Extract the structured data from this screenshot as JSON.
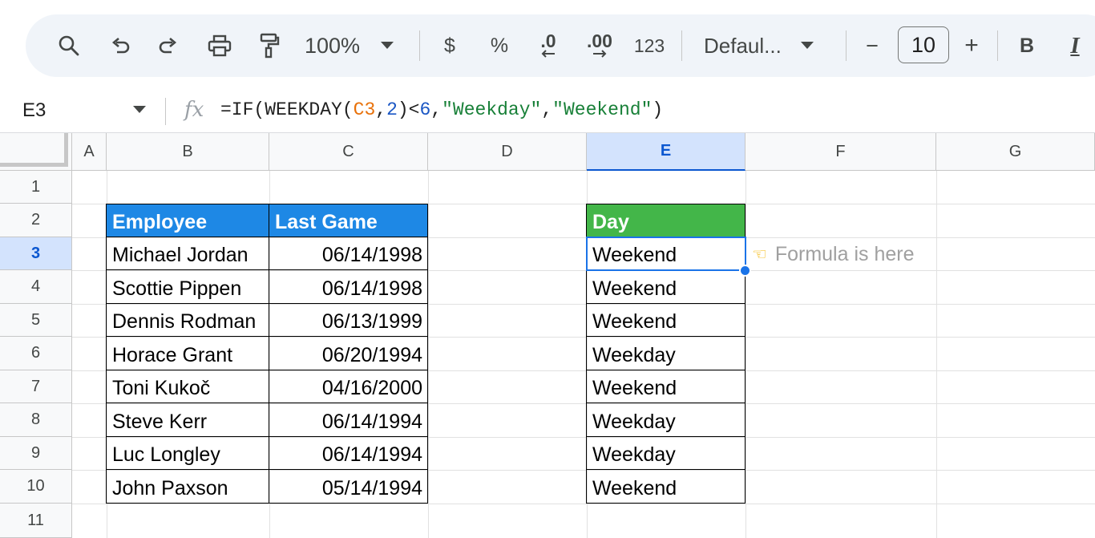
{
  "toolbar": {
    "zoom": "100%",
    "currency": "$",
    "percent": "%",
    "decrease_decimal": ".0",
    "increase_decimal": ".00",
    "more_formats": "123",
    "font_family": "Defaul...",
    "font_size": "10",
    "bold": "B",
    "italic": "I",
    "minus": "−",
    "plus": "+"
  },
  "formula_bar": {
    "name_box": "E3",
    "fx": "fx",
    "formula_parts": {
      "p1": "=IF(WEEKDAY(",
      "p2": "C3",
      "p3": ",",
      "p4": "2",
      "p5": ")<",
      "p6": "6",
      "p7": ",",
      "p8": "\"Weekday\"",
      "p9": ",",
      "p10": "\"Weekend\"",
      "p11": ")"
    }
  },
  "columns": [
    "A",
    "B",
    "C",
    "D",
    "E",
    "F",
    "G"
  ],
  "rows": [
    "1",
    "2",
    "3",
    "4",
    "5",
    "6",
    "7",
    "8",
    "9",
    "10",
    "11"
  ],
  "table": {
    "header_employee": "Employee",
    "header_last_game": "Last Game",
    "header_day": "Day",
    "rows": [
      {
        "employee": "Michael Jordan",
        "last_game": "06/14/1998",
        "day": "Weekend"
      },
      {
        "employee": "Scottie Pippen",
        "last_game": "06/14/1998",
        "day": "Weekend"
      },
      {
        "employee": "Dennis Rodman",
        "last_game": "06/13/1999",
        "day": "Weekend"
      },
      {
        "employee": "Horace Grant",
        "last_game": "06/20/1994",
        "day": "Weekday"
      },
      {
        "employee": "Toni Kukoč",
        "last_game": "04/16/2000",
        "day": "Weekend"
      },
      {
        "employee": "Steve Kerr",
        "last_game": "06/14/1994",
        "day": "Weekday"
      },
      {
        "employee": "Luc Longley",
        "last_game": "06/14/1994",
        "day": "Weekday"
      },
      {
        "employee": "John Paxson",
        "last_game": "05/14/1994",
        "day": "Weekend"
      }
    ]
  },
  "note": {
    "icon": "pointing-hand-left",
    "text": "Formula is here"
  },
  "colors": {
    "header_blue": "#1e88e5",
    "header_green": "#43b649",
    "selection": "#1a73e8"
  }
}
